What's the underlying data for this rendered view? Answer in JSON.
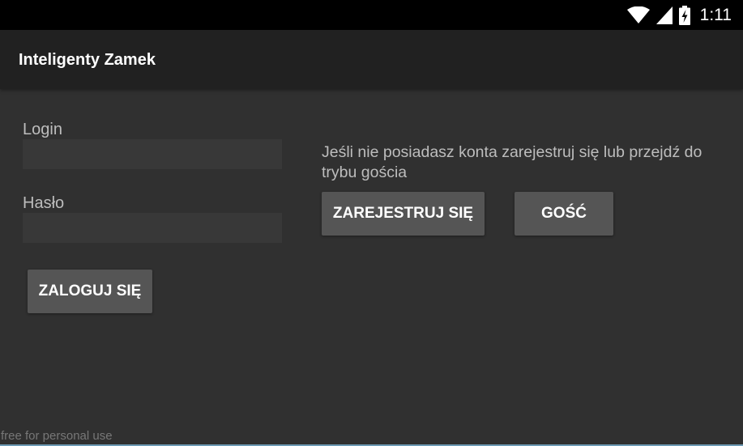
{
  "status_bar": {
    "time": "1:11",
    "icons": [
      "wifi-icon",
      "cell-signal-icon",
      "battery-charging-icon"
    ]
  },
  "app_bar": {
    "title": "Inteligenty Zamek"
  },
  "login_form": {
    "login_label": "Login",
    "login_value": "",
    "password_label": "Hasło",
    "password_value": "",
    "login_button": "ZALOGUJ SIĘ"
  },
  "register_panel": {
    "info": "Jeśli nie posiadasz konta zarejestruj się lub przejdź do trybu gościa",
    "register_button": "ZAREJESTRUJ SIĘ",
    "guest_button": "GOŚĆ"
  },
  "watermark": "free for personal use",
  "colors": {
    "background": "#303030",
    "app_bar": "#212121",
    "status_bar": "#000000",
    "button": "#555555",
    "input": "#383838",
    "label": "#bdbdbd"
  }
}
